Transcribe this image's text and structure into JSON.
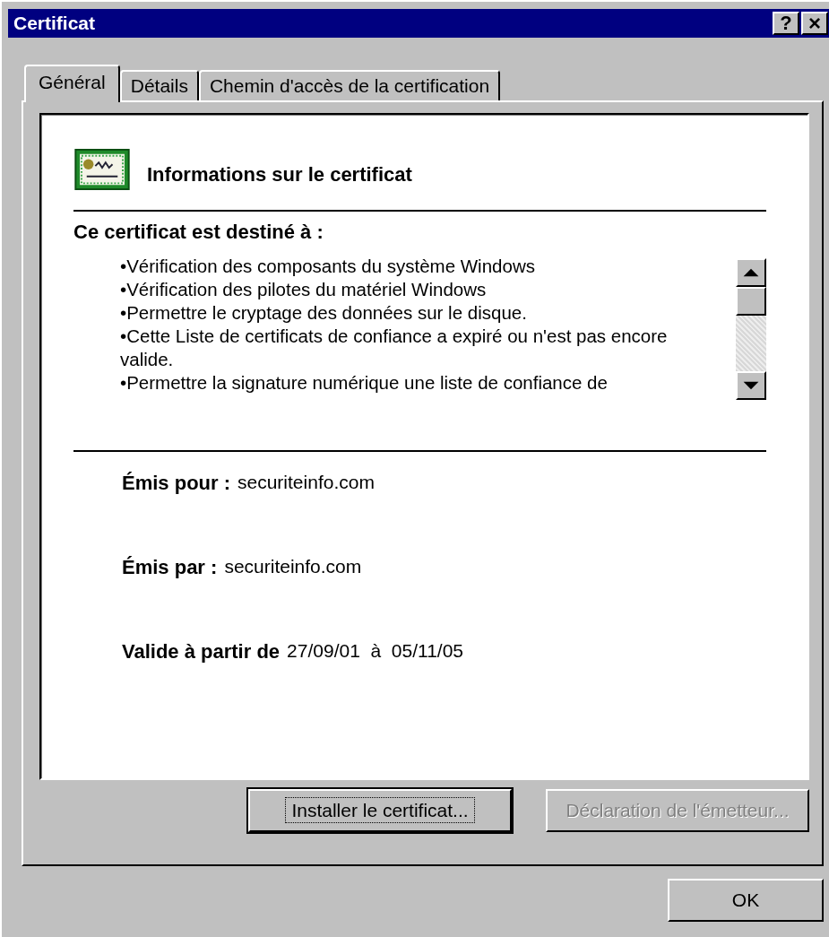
{
  "window": {
    "title": "Certificat"
  },
  "title_buttons": [
    {
      "kind": "help",
      "label": "?"
    },
    {
      "kind": "close",
      "label": "×"
    }
  ],
  "tabs": [
    {
      "label": "Général",
      "selected": true
    },
    {
      "label": "Détails",
      "selected": false
    },
    {
      "label": "Chemin d'accès de la certification",
      "selected": false
    }
  ],
  "header": {
    "title": "Informations sur le certificat"
  },
  "purpose": {
    "heading": "Ce certificat est destiné à :",
    "items": [
      "•Vérification des composants du système Windows",
      "•Vérification des pilotes du matériel Windows",
      "•Permettre le cryptage des données sur le disque.",
      "•Cette Liste de certificats de confiance a expiré ou n'est pas encore valide.",
      "•Permettre la signature numérique une liste de confiance de"
    ]
  },
  "fields": [
    {
      "label": "Émis pour :",
      "value": "securiteinfo.com"
    },
    {
      "label": "Émis par :",
      "value": "securiteinfo.com"
    },
    {
      "label": "Valide à partir de",
      "value": "27/09/01  à  05/11/05"
    }
  ],
  "panel_buttons": [
    {
      "label": "Installer le certificat...",
      "default": true,
      "disabled": false
    },
    {
      "label": "Déclaration de l'émetteur...",
      "default": false,
      "disabled": true
    }
  ],
  "ok_button": {
    "label": "OK"
  }
}
